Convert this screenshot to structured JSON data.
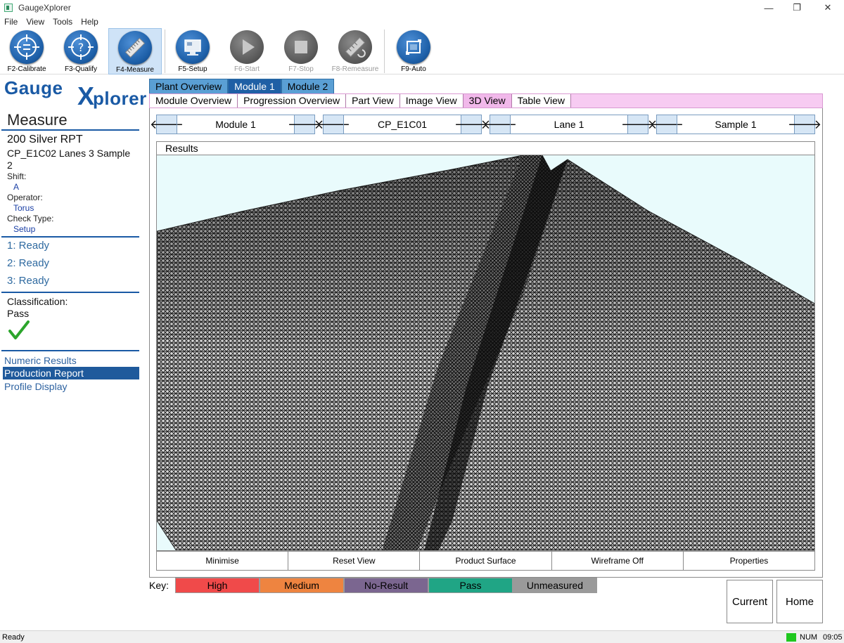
{
  "window": {
    "title": "GaugeXplorer",
    "minimize_glyph": "—",
    "maximize_glyph": "❐",
    "close_glyph": "✕"
  },
  "menu": [
    "File",
    "View",
    "Tools",
    "Help"
  ],
  "toolbar": [
    {
      "label": "F2-Calibrate",
      "icon": "target-icon",
      "state": "enabled"
    },
    {
      "label": "F3-Qualify",
      "icon": "question-target-icon",
      "state": "enabled"
    },
    {
      "label": "F4-Measure",
      "icon": "ruler-icon",
      "state": "active"
    },
    {
      "label": "F5-Setup",
      "icon": "monitor-icon",
      "state": "enabled"
    },
    {
      "label": "F6-Start",
      "icon": "play-icon",
      "state": "disabled"
    },
    {
      "label": "F7-Stop",
      "icon": "stop-icon",
      "state": "disabled"
    },
    {
      "label": "F8-Remeasure",
      "icon": "ruler-refresh-icon",
      "state": "disabled"
    },
    {
      "label": "F9-Auto",
      "icon": "auto-icon",
      "state": "enabled"
    }
  ],
  "logo": {
    "part1": "Gauge",
    "part2": "X",
    "part3": "plorer"
  },
  "left": {
    "heading": "Measure",
    "product": "200 Silver RPT",
    "sample_line1": "CP_E1C02 Lanes 3 Sample",
    "sample_line2": "2",
    "shift_label": "Shift:",
    "shift_value": "A",
    "operator_label": "Operator:",
    "operator_value": "Torus",
    "check_type_label": "Check Type:",
    "check_type_value": "Setup",
    "ready_items": [
      "1: Ready",
      "2: Ready",
      "3: Ready"
    ],
    "classification_label": "Classification:",
    "classification_value": "Pass",
    "links": [
      {
        "label": "Numeric Results",
        "selected": false
      },
      {
        "label": "Production Report",
        "selected": true
      },
      {
        "label": "Profile Display",
        "selected": false
      }
    ]
  },
  "tabs_top": [
    {
      "label": "Plant Overview",
      "active": false
    },
    {
      "label": "Module 1",
      "active": true
    },
    {
      "label": "Module 2",
      "active": false
    }
  ],
  "tabs_view": [
    {
      "label": "Module Overview",
      "active": false
    },
    {
      "label": "Progression Overview",
      "active": false
    },
    {
      "label": "Part View",
      "active": false
    },
    {
      "label": "Image View",
      "active": false
    },
    {
      "label": "3D View",
      "active": true
    },
    {
      "label": "Table View",
      "active": false
    }
  ],
  "nav": [
    {
      "value": "Module 1"
    },
    {
      "value": "CP_E1C01"
    },
    {
      "value": "Lane 1"
    },
    {
      "value": "Sample 1"
    }
  ],
  "nav_prev_glyph": "🡐",
  "nav_next_glyph": "🡒",
  "results_label": "Results",
  "view_buttons": [
    "Minimise",
    "Reset View",
    "Product Surface",
    "Wireframe Off",
    "Properties"
  ],
  "key_label": "Key:",
  "key": [
    {
      "label": "High",
      "color": "#f04a4a"
    },
    {
      "label": "Medium",
      "color": "#ee8440"
    },
    {
      "label": "No-Result",
      "color": "#7b6690"
    },
    {
      "label": "Pass",
      "color": "#20a585"
    },
    {
      "label": "Unmeasured",
      "color": "#9a9a9a"
    }
  ],
  "buttons": {
    "current": "Current",
    "home": "Home"
  },
  "status": {
    "text": "Ready",
    "num": "NUM",
    "time": "09:05"
  }
}
